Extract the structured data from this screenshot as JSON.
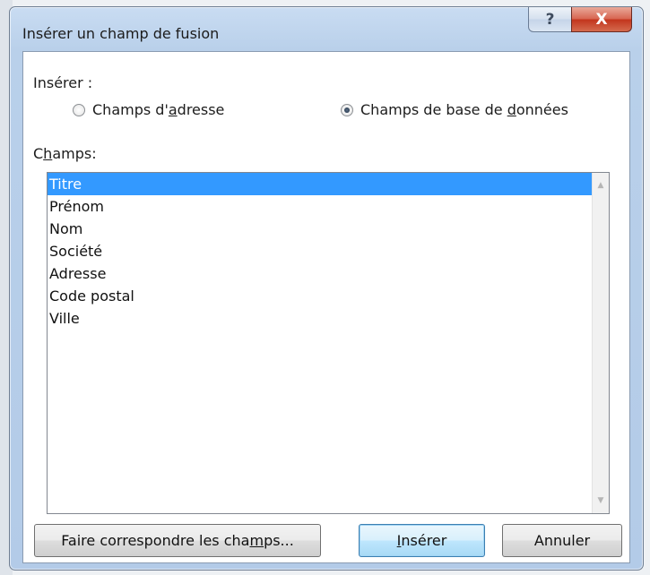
{
  "dialog": {
    "title": "Insérer un champ de fusion",
    "help_glyph": "?",
    "close_glyph": "X"
  },
  "insert_group": {
    "label": "Insérer :",
    "options": [
      {
        "pre": "Champs d'",
        "accel": "a",
        "post": "dresse",
        "selected": false
      },
      {
        "pre": "Champs de base de ",
        "accel": "d",
        "post": "onnées",
        "selected": true
      }
    ]
  },
  "fields": {
    "label_pre": "C",
    "label_accel": "h",
    "label_post": "amps:",
    "items": [
      "Titre",
      "Prénom",
      "Nom",
      "Société",
      "Adresse",
      "Code postal",
      "Ville"
    ],
    "selected_index": 0
  },
  "scrollbar": {
    "up_glyph": "▲",
    "down_glyph": "▼"
  },
  "buttons": {
    "match": {
      "pre": "Faire correspondre les cha",
      "accel": "m",
      "post": "ps..."
    },
    "insert": {
      "pre": "",
      "accel": "I",
      "post": "nsérer"
    },
    "cancel": "Annuler"
  },
  "colors": {
    "selection": "#3399ff",
    "close_button": "#c7432a",
    "title_bar": "#b9d0ea"
  }
}
